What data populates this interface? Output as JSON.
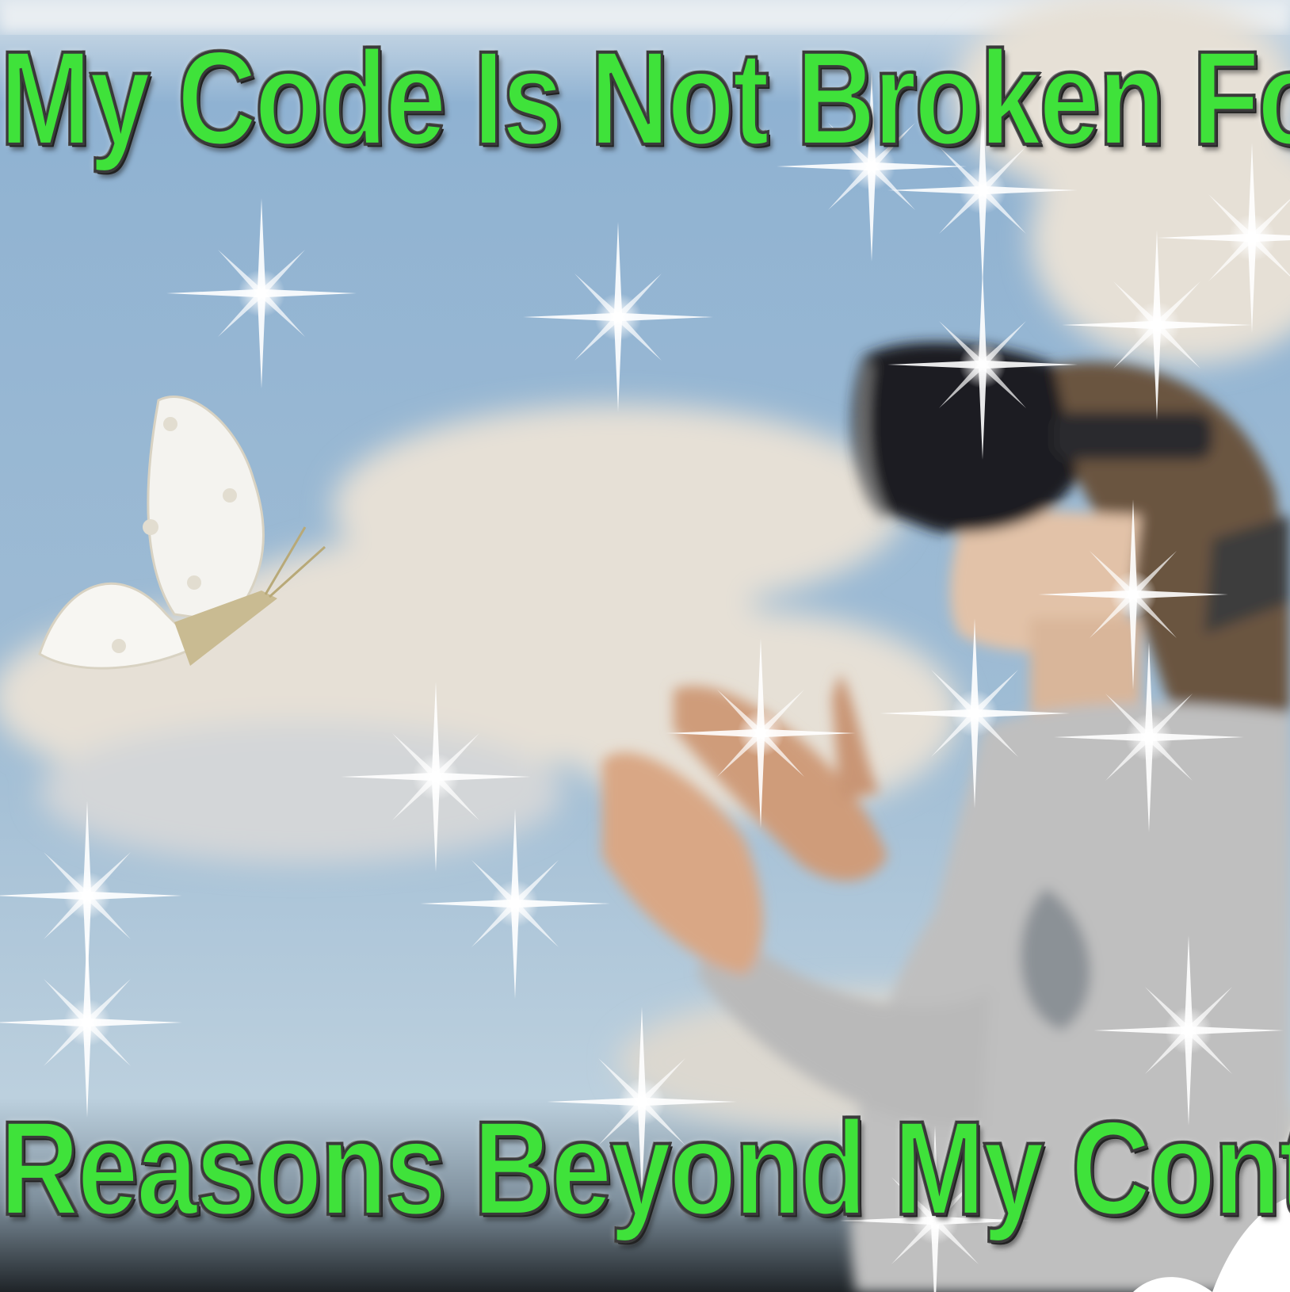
{
  "meme": {
    "top_text": "My Code Is Not Broken For",
    "bottom_text": "Reasons Beyond My Control"
  },
  "colors": {
    "text_fill": "#3fe23a",
    "text_outline": "#3a3a3a",
    "sky": "#9fb9d0"
  },
  "icons": [
    "butterfly-icon",
    "sparkle-icon",
    "vr-headset"
  ]
}
